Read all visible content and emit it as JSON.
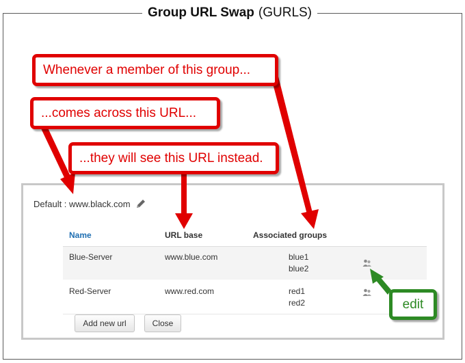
{
  "header": {
    "title": "Group URL Swap",
    "abbr": "(GURLS)"
  },
  "default": {
    "label": "Default : www.black.com"
  },
  "table": {
    "headers": {
      "name": "Name",
      "url_base": "URL base",
      "groups": "Associated groups"
    },
    "rows": [
      {
        "name": "Blue-Server",
        "url": "www.blue.com",
        "groups": [
          "blue1",
          "blue2"
        ]
      },
      {
        "name": "Red-Server",
        "url": "www.red.com",
        "groups": [
          "red1",
          "red2"
        ]
      }
    ]
  },
  "buttons": {
    "add": "Add new url",
    "close": "Close"
  },
  "callouts": {
    "member": "Whenever a member of this group...",
    "url": "...comes across this URL...",
    "instead": "...they will see this URL instead.",
    "edit": "edit"
  },
  "colors": {
    "callout_red": "#e00000",
    "callout_green": "#2d8a24",
    "link_blue": "#1f6fb2"
  },
  "icons": [
    "pencil-icon",
    "people-icon"
  ]
}
